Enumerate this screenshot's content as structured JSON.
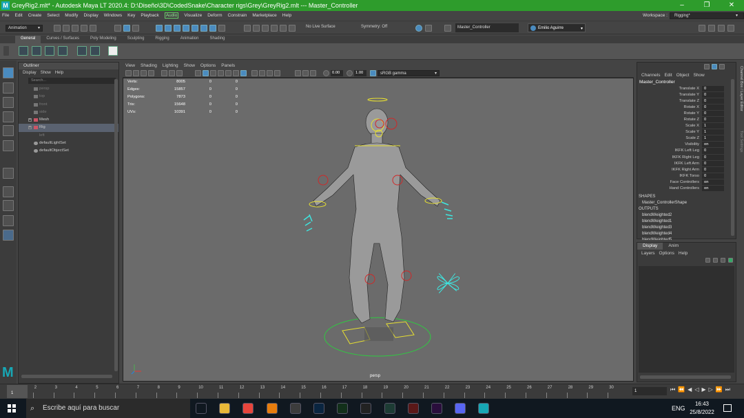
{
  "title_bar": {
    "title": "GreyRig2.mlt* - Autodesk Maya LT 2020.4: D:\\Diseño\\3D\\CodedSnake\\Character rigs\\Grey\\GreyRig2.mlt   ---   Master_Controller",
    "logo": "M"
  },
  "menu": {
    "items": [
      "File",
      "Edit",
      "Create",
      "Select",
      "Modify",
      "Display",
      "Windows",
      "Key",
      "Playback"
    ],
    "audio": "Audio",
    "items2": [
      "Visualize",
      "Deform",
      "Constrain",
      "Marketplace",
      "Help"
    ],
    "workspace_label": "Workspace :",
    "workspace_value": "Rigging*"
  },
  "status_line": {
    "mode": "Animation",
    "live_surface": "No Live Surface",
    "symmetry": "Symmetry: Off",
    "object_field": "Master_Controller",
    "user": "Emilio Aguirre"
  },
  "shelf_tabs": [
    "General",
    "Curves / Surfaces",
    "Poly Modeling",
    "Sculpting",
    "Rigging",
    "Animation",
    "Shading"
  ],
  "outliner": {
    "title": "Outliner",
    "menu": [
      "Display",
      "Show",
      "Help"
    ],
    "search_placeholder": "Search...",
    "items": [
      {
        "label": "persp",
        "dim": true
      },
      {
        "label": "top",
        "dim": true
      },
      {
        "label": "front",
        "dim": true
      },
      {
        "label": "side",
        "dim": true
      },
      {
        "label": "Mesh",
        "dim": false
      },
      {
        "label": "Rig",
        "dim": false
      },
      {
        "label": "left",
        "dim": true
      },
      {
        "label": "defaultLightSet",
        "dim": false
      },
      {
        "label": "defaultObjectSet",
        "dim": false
      }
    ]
  },
  "viewport": {
    "menu": [
      "View",
      "Shading",
      "Lighting",
      "Show",
      "Options",
      "Panels"
    ],
    "exposure": "0.00",
    "gamma": "1.00",
    "color_space": "sRGB gamma",
    "camera_label": "persp",
    "hud": [
      {
        "k": "Verts:",
        "v": "8005",
        "a": "0",
        "b": "0"
      },
      {
        "k": "Edges:",
        "v": "15857",
        "a": "0",
        "b": "0"
      },
      {
        "k": "Polygons:",
        "v": "7873",
        "a": "0",
        "b": "0"
      },
      {
        "k": "Tris:",
        "v": "15648",
        "a": "0",
        "b": "0"
      },
      {
        "k": "UVs:",
        "v": "10391",
        "a": "0",
        "b": "0"
      }
    ]
  },
  "channel_box": {
    "menu": [
      "Channels",
      "Edit",
      "Object",
      "Show"
    ],
    "node": "Master_Controller",
    "attrs": [
      {
        "n": "Translate X",
        "v": "0"
      },
      {
        "n": "Translate Y",
        "v": "0"
      },
      {
        "n": "Translate Z",
        "v": "0"
      },
      {
        "n": "Rotate X",
        "v": "0"
      },
      {
        "n": "Rotate Y",
        "v": "0"
      },
      {
        "n": "Rotate Z",
        "v": "0"
      },
      {
        "n": "Scale X",
        "v": "1"
      },
      {
        "n": "Scale Y",
        "v": "1"
      },
      {
        "n": "Scale Z",
        "v": "1"
      },
      {
        "n": "Visibility",
        "v": "on"
      },
      {
        "n": "IKFK Left Leg",
        "v": "0"
      },
      {
        "n": "IKFK Right Leg",
        "v": "0"
      },
      {
        "n": "IKFK Left Arm",
        "v": "0"
      },
      {
        "n": "IKFK Right Arm",
        "v": "0"
      },
      {
        "n": "IKFK Torso",
        "v": "0"
      },
      {
        "n": "Face Controllers",
        "v": "on"
      },
      {
        "n": "Hand Controllers",
        "v": "on"
      }
    ],
    "shapes_label": "SHAPES",
    "shape": "Master_ControllerShape",
    "outputs_label": "OUTPUTS",
    "outputs": [
      "blendWeighted2",
      "blendWeighted1",
      "blendWeighted3",
      "blendWeighted4",
      "blendWeighted5"
    ],
    "side_tabs": "Channel Box / Layer Editor",
    "side_tabs2": "Tool Settings"
  },
  "layer_editor": {
    "tabs": [
      "Display",
      "Anim"
    ],
    "menu": [
      "Layers",
      "Options",
      "Help"
    ]
  },
  "timeline": {
    "ticks": [
      "1",
      "2",
      "3",
      "4",
      "5",
      "6",
      "7",
      "8",
      "9",
      "10",
      "11",
      "12",
      "13",
      "14",
      "15",
      "16",
      "17",
      "18",
      "19",
      "20",
      "21",
      "22",
      "23",
      "24",
      "25",
      "26",
      "27",
      "28",
      "29",
      "30"
    ],
    "current_frame": "1",
    "frame_field": "1"
  },
  "taskbar": {
    "search": "Escribe aquí para buscar",
    "lang": "ENG",
    "time": "16:43",
    "date": "25/8/2022",
    "apps": [
      {
        "name": "task-view",
        "color": "#101820"
      },
      {
        "name": "file-explorer",
        "color": "#e8b838"
      },
      {
        "name": "chrome",
        "color": "#e8453c"
      },
      {
        "name": "blender",
        "color": "#e87d0d"
      },
      {
        "name": "obs",
        "color": "#3c3c3c"
      },
      {
        "name": "photoshop",
        "color": "#0a2540"
      },
      {
        "name": "prelude",
        "color": "#12301a"
      },
      {
        "name": "inkscape",
        "color": "#222222"
      },
      {
        "name": "audition",
        "color": "#1d3c34"
      },
      {
        "name": "app-red",
        "color": "#5a1818"
      },
      {
        "name": "premiere",
        "color": "#2a0e3c"
      },
      {
        "name": "discord",
        "color": "#5865f2"
      },
      {
        "name": "maya",
        "color": "#17a7b5"
      }
    ]
  },
  "colors": {
    "titlebar": "#2e9c2c",
    "controller_yellow": "#e8e030",
    "controller_cyan": "#3ee6e0",
    "controller_red": "#d02828",
    "controller_green": "#2ecc40"
  }
}
